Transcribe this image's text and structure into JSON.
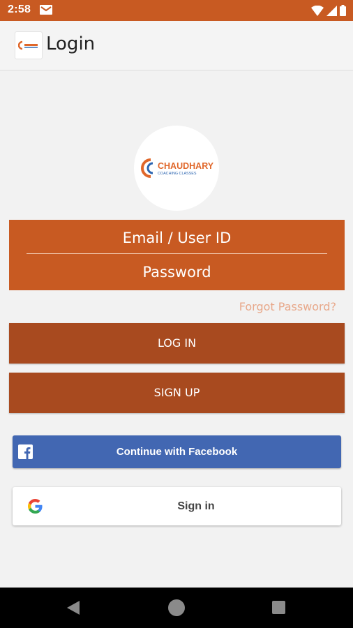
{
  "status_bar": {
    "time": "2:58",
    "icons": [
      "gmail-icon",
      "wifi-icon",
      "cell-signal-icon",
      "battery-icon"
    ],
    "color": "#c85a22"
  },
  "app_bar": {
    "title": "Login",
    "logo_icon": "chaudhary-logo-icon"
  },
  "brand": {
    "name": "CHAUDHARY",
    "tagline": "COACHING CLASSES",
    "primary_color": "#c85a22",
    "button_color": "#a84a1f"
  },
  "form": {
    "email_placeholder": "Email / User ID",
    "password_placeholder": "Password",
    "forgot_label": "Forgot Password?"
  },
  "buttons": {
    "login_label": "LOG IN",
    "signup_label": "SIGN UP"
  },
  "social": {
    "facebook_label": "Continue with Facebook",
    "facebook_color": "#4267b2",
    "google_label": "Sign in"
  },
  "nav_bar": {
    "icons": [
      "back-icon",
      "home-icon",
      "recents-icon"
    ]
  }
}
